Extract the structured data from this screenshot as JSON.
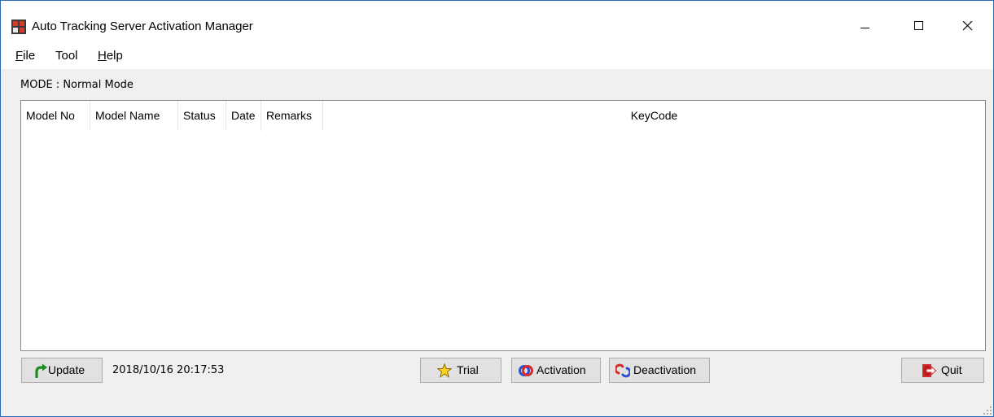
{
  "window": {
    "title": "Auto Tracking Server Activation Manager",
    "app_icon": "app-icon",
    "controls": {
      "minimize": "minimize-icon",
      "maximize": "maximize-icon",
      "close": "close-icon"
    }
  },
  "menu": {
    "file": {
      "mnemonic": "F",
      "rest": "ile"
    },
    "tool": {
      "label": "Tool"
    },
    "help": {
      "mnemonic": "H",
      "rest": "elp"
    }
  },
  "mode": {
    "label": "MODE : Normal Mode"
  },
  "list": {
    "columns": [
      "Model No",
      "Model Name",
      "Status",
      "Date",
      "Remarks",
      "KeyCode"
    ],
    "rows": []
  },
  "toolbar": {
    "update": {
      "label": "Update",
      "icon": "refresh-icon"
    },
    "timestamp": "2018/10/16 20:17:53",
    "trial": {
      "label": "Trial",
      "icon": "star-icon"
    },
    "activation": {
      "label": "Activation",
      "icon": "activation-icon"
    },
    "deactivation": {
      "label": "Deactivation",
      "icon": "deactivation-icon"
    },
    "quit": {
      "label": "Quit",
      "icon": "exit-icon"
    }
  },
  "colors": {
    "window_border": "#2b6cb8",
    "background": "#f0f0f0",
    "button_face": "#e1e1e1",
    "button_border": "#adadad"
  }
}
